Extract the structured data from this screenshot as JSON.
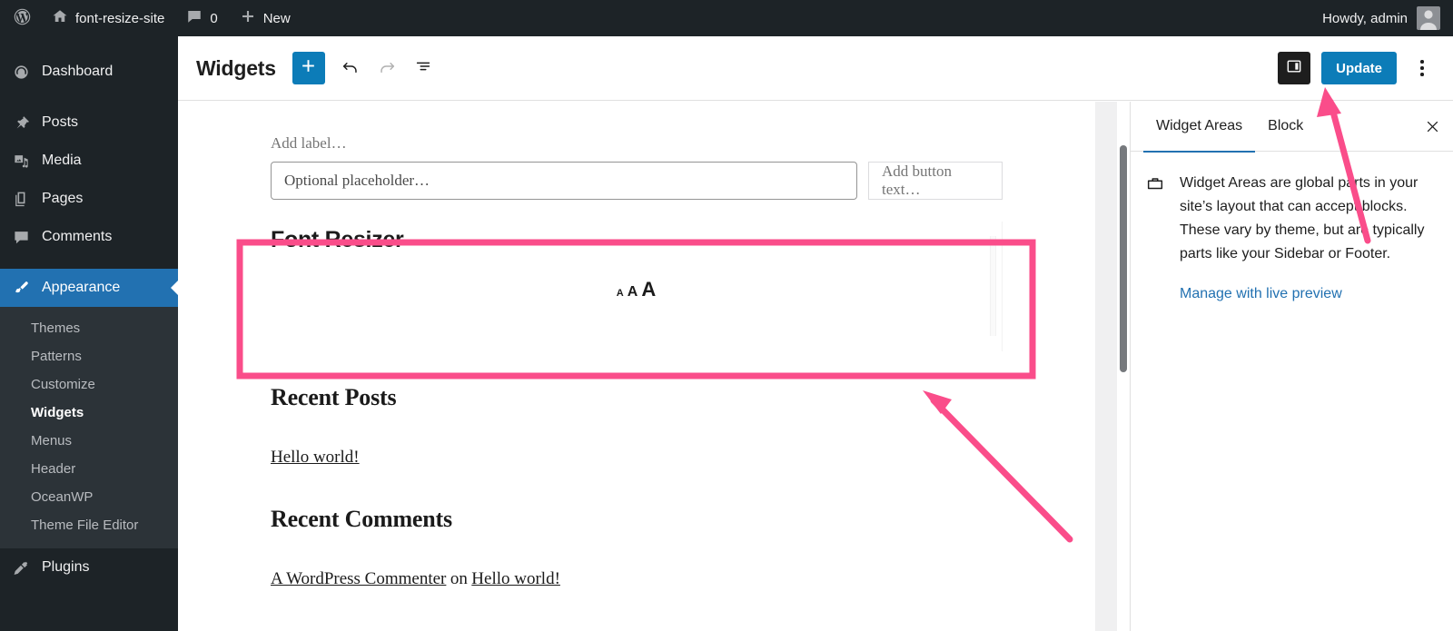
{
  "adminbar": {
    "logo_icon": "wordpress-logo-icon",
    "home_icon": "home-icon",
    "site_name": "font-resize-site",
    "comments_icon": "comment-bubble-icon",
    "comments_count": "0",
    "new_icon": "plus-icon",
    "new_label": "New",
    "howdy": "Howdy, admin",
    "avatar_icon": "user-avatar-icon"
  },
  "sidebar": {
    "items": [
      {
        "label": "Dashboard",
        "icon": "dashboard-icon",
        "current": false
      },
      {
        "label": "Posts",
        "icon": "pin-icon",
        "current": false
      },
      {
        "label": "Media",
        "icon": "media-icon",
        "current": false
      },
      {
        "label": "Pages",
        "icon": "pages-icon",
        "current": false
      },
      {
        "label": "Comments",
        "icon": "comment-bubble-icon",
        "current": false
      },
      {
        "label": "Appearance",
        "icon": "paintbrush-icon",
        "current": true
      }
    ],
    "submenu": [
      {
        "label": "Themes",
        "current": false
      },
      {
        "label": "Patterns",
        "current": false
      },
      {
        "label": "Customize",
        "current": false
      },
      {
        "label": "Widgets",
        "current": true
      },
      {
        "label": "Menus",
        "current": false
      },
      {
        "label": "Header",
        "current": false
      },
      {
        "label": "OceanWP",
        "current": false
      },
      {
        "label": "Theme File Editor",
        "current": false
      }
    ],
    "after": [
      {
        "label": "Plugins",
        "icon": "plug-icon",
        "current": false
      }
    ]
  },
  "toolbar": {
    "title": "Widgets",
    "add_block_icon": "plus-icon",
    "undo_icon": "undo-arrow-icon",
    "redo_icon": "redo-arrow-icon",
    "list_view_icon": "list-view-icon",
    "sidebar_toggle_icon": "settings-sidebar-icon",
    "update_label": "Update",
    "more_menu_icon": "vertical-ellipsis-icon"
  },
  "canvas": {
    "search_block": {
      "label_placeholder": "Add label…",
      "input_placeholder": "Optional placeholder…",
      "button_placeholder": "Add button text…"
    },
    "font_resizer": {
      "title": "Font Resizer",
      "size_small": "A",
      "size_medium": "A",
      "size_large": "A"
    },
    "recent_posts": {
      "heading": "Recent Posts",
      "items": [
        "Hello world!"
      ]
    },
    "recent_comments": {
      "heading": "Recent Comments",
      "author": "A WordPress Commenter",
      "separator": "on",
      "post": "Hello world!"
    }
  },
  "settings": {
    "tabs": [
      {
        "label": "Widget Areas",
        "active": true
      },
      {
        "label": "Block",
        "active": false
      }
    ],
    "close_icon": "close-icon",
    "panel_icon": "widget-area-icon",
    "description": "Widget Areas are global parts in your site’s layout that can accept blocks. These vary by theme, but are typically parts like your Sidebar or Footer.",
    "link_label": "Manage with live preview"
  },
  "annotations": {
    "highlight_color": "#fa4d8a",
    "highlight_target": "font-resizer-block",
    "arrow_to_block": "arrow pointing to Font Resizer block",
    "arrow_to_update": "arrow pointing to Update button"
  },
  "colors": {
    "admin_dark": "#1d2327",
    "admin_submenu": "#2c3338",
    "accent_blue": "#2271b1",
    "button_blue": "#0c7cb8",
    "annotation_pink": "#fa4d8a"
  }
}
